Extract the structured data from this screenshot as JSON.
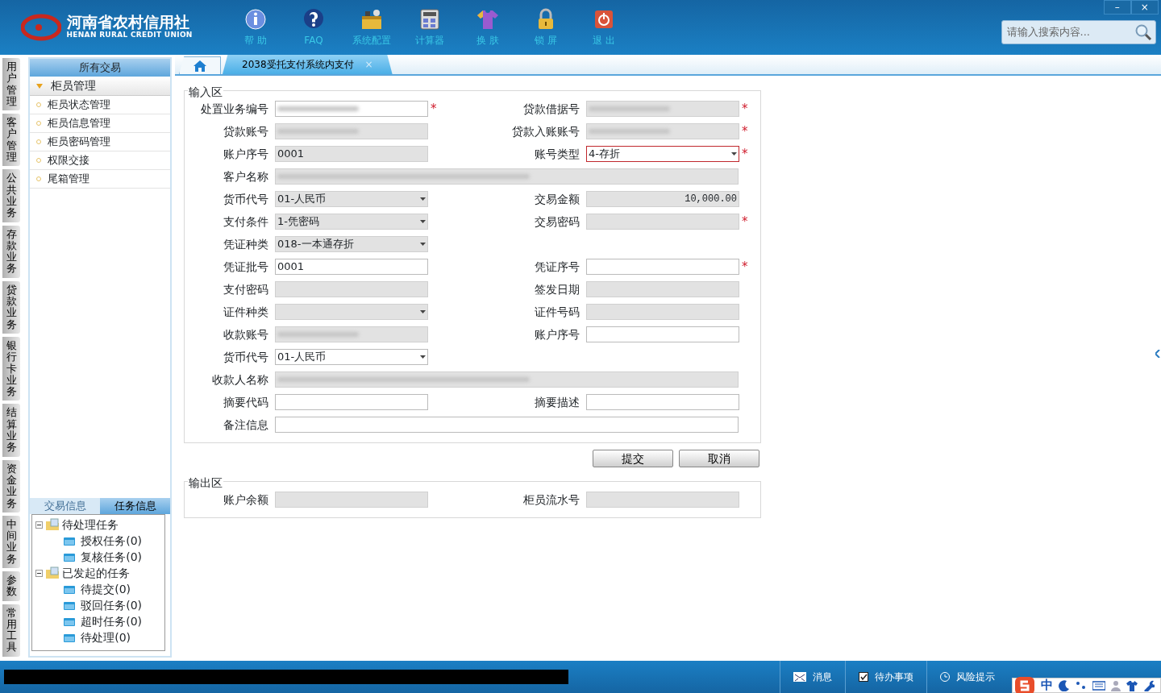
{
  "header": {
    "logo_cn": "河南省农村信用社",
    "logo_en": "HENAN RURAL CREDIT UNION",
    "tools": [
      {
        "label": "帮 助",
        "kind": "info"
      },
      {
        "label": "FAQ",
        "kind": "faq"
      },
      {
        "label": "系统配置",
        "kind": "config"
      },
      {
        "label": "计算器",
        "kind": "calc"
      },
      {
        "label": "换 肤",
        "kind": "skin"
      },
      {
        "label": "锁 屏",
        "kind": "lock"
      },
      {
        "label": "退 出",
        "kind": "exit"
      }
    ],
    "search": {
      "placeholder": "请输入搜索内容..."
    },
    "window_buttons": [
      "–",
      "×"
    ]
  },
  "side_tabs": [
    "用户管理",
    "客户管理",
    "公共业务",
    "存款业务",
    "贷款业务",
    "银行卡业务",
    "结算业务",
    "资金业务",
    "中间业务",
    "参数",
    "常用工具"
  ],
  "sidebar": {
    "title": "所有交易",
    "group": {
      "label": "柜员管理",
      "expanded": true
    },
    "items": [
      "柜员状态管理",
      "柜员信息管理",
      "柜员密码管理",
      "权限交接",
      "尾箱管理"
    ],
    "tabs": [
      {
        "label": "交易信息",
        "selected": false
      },
      {
        "label": "任务信息",
        "selected": true
      }
    ],
    "tree": [
      {
        "label": "待处理任务",
        "expanded": true,
        "children": [
          {
            "label": "授权任务(0)"
          },
          {
            "label": "复核任务(0)"
          }
        ]
      },
      {
        "label": "已发起的任务",
        "expanded": true,
        "children": [
          {
            "label": "待提交(0)"
          },
          {
            "label": "驳回任务(0)"
          },
          {
            "label": "超时任务(0)"
          },
          {
            "label": "待处理(0)"
          }
        ]
      }
    ]
  },
  "tabs": [
    {
      "kind": "home",
      "selected": false
    },
    {
      "kind": "page",
      "label": "2038受托支付系统内支付",
      "selected": true,
      "close": "×"
    }
  ],
  "input_area": {
    "title": "输入区",
    "rows": [
      [
        {
          "label": "处置业务编号",
          "kind": "text",
          "blurred": true,
          "disabled": false,
          "required": true
        },
        {
          "label": "贷款借据号",
          "kind": "text",
          "blurred": true,
          "disabled": true,
          "required": true
        }
      ],
      [
        {
          "label": "贷款账号",
          "kind": "text",
          "blurred": true,
          "disabled": true
        },
        {
          "label": "贷款入账账号",
          "kind": "text",
          "blurred": true,
          "disabled": true,
          "required": true
        }
      ],
      [
        {
          "label": "账户序号",
          "kind": "text",
          "value": "0001",
          "disabled": true
        },
        {
          "label": "账号类型",
          "kind": "select",
          "value": "4-存折",
          "disabled": false,
          "required": true,
          "error": true
        }
      ],
      [
        {
          "label": "客户名称",
          "kind": "wide",
          "blurred": true,
          "disabled": true
        }
      ],
      [
        {
          "label": "货币代号",
          "kind": "select",
          "value": "01-人民币",
          "disabled": true
        },
        {
          "label": "交易金额",
          "kind": "amount",
          "value": "10,000.00",
          "disabled": true
        }
      ],
      [
        {
          "label": "支付条件",
          "kind": "select",
          "value": "1-凭密码",
          "disabled": true
        },
        {
          "label": "交易密码",
          "kind": "text",
          "disabled": true,
          "required": true
        }
      ],
      [
        {
          "label": "凭证种类",
          "kind": "select",
          "value": "018-一本通存折",
          "disabled": true
        }
      ],
      [
        {
          "label": "凭证批号",
          "kind": "text",
          "value": "0001",
          "disabled": false
        },
        {
          "label": "凭证序号",
          "kind": "text",
          "disabled": false,
          "required": true
        }
      ],
      [
        {
          "label": "支付密码",
          "kind": "text",
          "disabled": true
        },
        {
          "label": "签发日期",
          "kind": "text",
          "disabled": true
        }
      ],
      [
        {
          "label": "证件种类",
          "kind": "select",
          "disabled": true
        },
        {
          "label": "证件号码",
          "kind": "text",
          "disabled": true
        }
      ],
      [
        {
          "label": "收款账号",
          "kind": "text",
          "blurred": true,
          "disabled": true
        },
        {
          "label": "账户序号",
          "kind": "text",
          "disabled": false
        }
      ],
      [
        {
          "label": "货币代号",
          "kind": "select",
          "value": "01-人民币",
          "disabled": false
        }
      ],
      [
        {
          "label": "收款人名称",
          "kind": "wide",
          "blurred": true,
          "disabled": true
        }
      ],
      [
        {
          "label": "摘要代码",
          "kind": "text",
          "disabled": false
        },
        {
          "label": "摘要描述",
          "kind": "text",
          "disabled": false
        }
      ],
      [
        {
          "label": "备注信息",
          "kind": "wide",
          "disabled": false
        }
      ]
    ]
  },
  "required_mark": "*",
  "actions": [
    "提交",
    "取消"
  ],
  "output_area": {
    "title": "输出区",
    "rows": [
      [
        {
          "label": "账户余额",
          "kind": "text",
          "disabled": true
        },
        {
          "label": "柜员流水号",
          "kind": "text",
          "disabled": true
        }
      ]
    ]
  },
  "status_bar": [
    {
      "label": "消息",
      "kind": "mail"
    },
    {
      "label": "待办事项",
      "kind": "check"
    },
    {
      "label": "风险提示",
      "kind": "clock"
    }
  ],
  "ime_bar": {
    "label": "中"
  }
}
